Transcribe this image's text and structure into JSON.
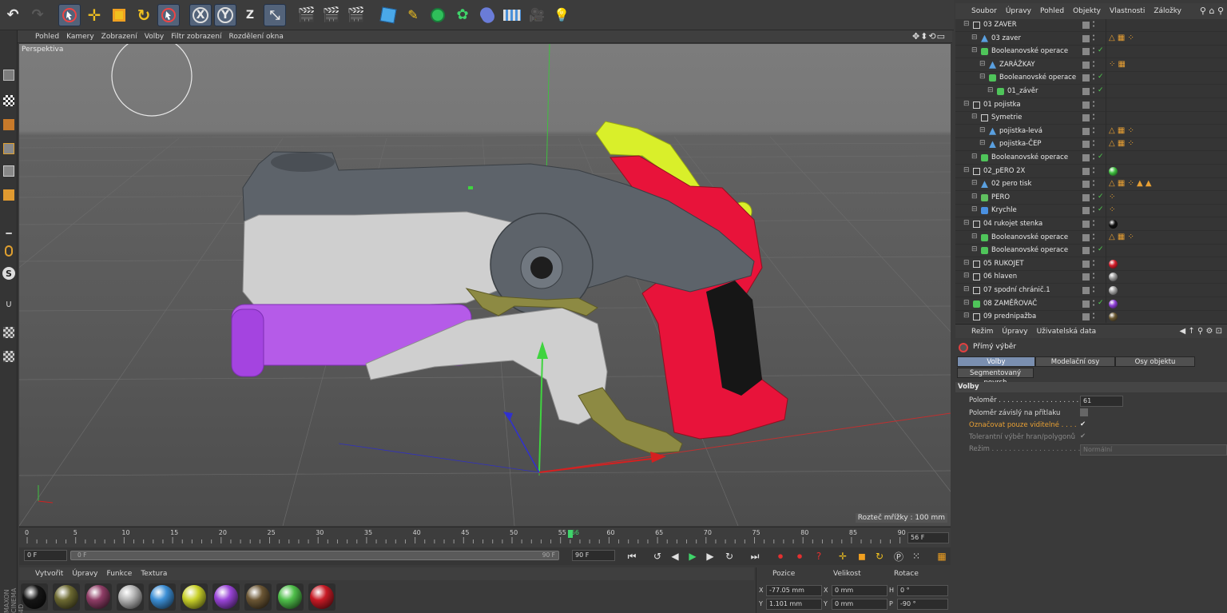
{
  "colors": {
    "accent": "#7a8fb0",
    "highlight_orange": "#e8a034",
    "check_green": "#4fd14f",
    "gun_gray": "#5d636a",
    "gun_white": "#cfcfcf",
    "gun_red": "#e8133a",
    "gun_yellow": "#d9ef2a",
    "gun_purple": "#b55be8",
    "gun_olive": "#8d8a43"
  },
  "top_toolbar": {
    "icons": [
      "undo-icon",
      "redo-icon",
      "live-select-icon",
      "move-icon",
      "scale-icon",
      "rotate-icon",
      "recent-tool-icon",
      "x-axis-lock",
      "y-axis-lock",
      "z-axis-lock",
      "world-coordinates-icon",
      "render-view-icon",
      "render-picture-viewer-icon",
      "render-settings-icon",
      "cube-icon",
      "pen-icon",
      "subdivision-icon",
      "array-icon",
      "deformer-icon",
      "floor-icon",
      "camera-icon",
      "light-icon"
    ],
    "x_label": "X",
    "y_label": "Y",
    "z_label": "Z"
  },
  "viewport": {
    "menu": [
      "Pohled",
      "Kamery",
      "Zobrazení",
      "Volby",
      "Filtr zobrazení",
      "Rozdělení okna"
    ],
    "label": "Perspektiva",
    "grid_spacing": "Rozteč mřížky : 100 mm"
  },
  "timeline": {
    "ticks": [
      "0",
      "5",
      "10",
      "15",
      "20",
      "25",
      "30",
      "35",
      "40",
      "45",
      "50",
      "55",
      "56",
      "60",
      "65",
      "70",
      "75",
      "80",
      "85",
      "90"
    ],
    "current_frame": "56 F",
    "start_field": "0 F",
    "range_start": "0 F",
    "range_end": "90 F",
    "end_field": "90 F"
  },
  "material_manager": {
    "menu": [
      "Vytvořit",
      "Úpravy",
      "Funkce",
      "Textura"
    ],
    "swatches": [
      "#151515",
      "#6d6a32",
      "#8f3d66",
      "#b5b5b5",
      "#3c8fd6",
      "#c9d12a",
      "#9a45d8",
      "#6b5634",
      "#4fbf4a",
      "#c81a25"
    ],
    "side_label": "MAXON CINEMA 4D"
  },
  "coordinates": {
    "headers": [
      "Pozice",
      "Velikost",
      "Rotace"
    ],
    "rows": [
      {
        "axis": "X",
        "pos": "-77.05 mm",
        "size_axis": "X",
        "size": "0 mm",
        "rot_axis": "H",
        "rot": "0 °"
      },
      {
        "axis": "Y",
        "pos": "1.101 mm",
        "size_axis": "Y",
        "size": "0 mm",
        "rot_axis": "P",
        "rot": "-90 °"
      }
    ]
  },
  "object_manager": {
    "menu": [
      "Soubor",
      "Úpravy",
      "Pohled",
      "Objekty",
      "Vlastnosti",
      "Záložky"
    ],
    "rows": [
      {
        "name": "03 ZAVER",
        "indent": 0,
        "icon": "null",
        "check": false,
        "tags": ""
      },
      {
        "name": "03 zaver",
        "indent": 1,
        "icon": "poly",
        "check": false,
        "tags": "△ ▦ ⁘"
      },
      {
        "name": "Booleanovské operace",
        "indent": 1,
        "icon": "bool",
        "check": true,
        "tags": ""
      },
      {
        "name": "ZARÁŽKAY",
        "indent": 2,
        "icon": "poly",
        "check": false,
        "tags": "⁘ ▦"
      },
      {
        "name": "Booleanovské operace",
        "indent": 2,
        "icon": "bool",
        "check": true,
        "tags": ""
      },
      {
        "name": "01_závěr",
        "indent": 3,
        "icon": "bool",
        "check": true,
        "tags": ""
      },
      {
        "name": "01 pojistka",
        "indent": 0,
        "icon": "null",
        "check": false,
        "tags": ""
      },
      {
        "name": "Symetrie",
        "indent": 1,
        "icon": "null",
        "check": false,
        "tags": ""
      },
      {
        "name": "pojistka-levá",
        "indent": 2,
        "icon": "poly",
        "check": false,
        "tags": "△ ▦ ⁘"
      },
      {
        "name": "pojistka-ČEP",
        "indent": 2,
        "icon": "poly",
        "check": false,
        "tags": "△ ▦ ⁘"
      },
      {
        "name": "Booleanovské operace",
        "indent": 1,
        "icon": "bool",
        "check": true,
        "tags": ""
      },
      {
        "name": "02_pERO 2X",
        "indent": 0,
        "icon": "null",
        "check": false,
        "tags": "●"
      },
      {
        "name": "02 pero tisk",
        "indent": 1,
        "icon": "poly",
        "check": false,
        "tags": "△ ▦ ⁘ ▲ ▲"
      },
      {
        "name": "PERO",
        "indent": 1,
        "icon": "spline",
        "check": true,
        "tags": "⁘"
      },
      {
        "name": "Krychle",
        "indent": 1,
        "icon": "cube",
        "check": true,
        "tags": "⁘"
      },
      {
        "name": "04 rukojet stenka",
        "indent": 0,
        "icon": "null",
        "check": false,
        "tags": "●"
      },
      {
        "name": "Booleanovské operace",
        "indent": 1,
        "icon": "bool",
        "check": false,
        "tags": "△ ▦ ⁘"
      },
      {
        "name": "Booleanovské operace",
        "indent": 1,
        "icon": "bool",
        "check": true,
        "tags": ""
      },
      {
        "name": "05 RUKOJET",
        "indent": 0,
        "icon": "null",
        "check": false,
        "tags": "●"
      },
      {
        "name": "06 hlaven",
        "indent": 0,
        "icon": "null",
        "check": false,
        "tags": "●"
      },
      {
        "name": "07 spodní chránič.1",
        "indent": 0,
        "icon": "null",
        "check": false,
        "tags": "●"
      },
      {
        "name": "08 ZAMĚŘOVAČ",
        "indent": 0,
        "icon": "bool",
        "check": true,
        "tags": "●"
      },
      {
        "name": "09 prednipažba",
        "indent": 0,
        "icon": "null",
        "check": false,
        "tags": "●"
      }
    ],
    "tag_sphere_colors": {
      "11": "#3fbf3f",
      "15": "#111111",
      "18": "#d41d2a",
      "19": "#9a9a9a",
      "20": "#a0a0a0",
      "21": "#8e3fd6",
      "22": "#6b5a34"
    }
  },
  "attribute_manager": {
    "menu": [
      "Režim",
      "Úpravy",
      "Uživatelská data"
    ],
    "tool_name": "Přímý výběr",
    "tabs": [
      "Volby",
      "Modelační osy",
      "Osy objektu"
    ],
    "tab2": "Segmentovaný povrch",
    "section": "Volby",
    "props": [
      {
        "label": "Poloměr . . . . . . . . . . . . . . . . . . . . . . . . . . .",
        "value": "61",
        "style": "normal"
      },
      {
        "label": "Poloměr závislý na přítlaku",
        "value": "",
        "style": "normal"
      },
      {
        "label": "Označovat pouze viditelné . . . .",
        "value": "✔",
        "style": "orange"
      },
      {
        "label": "Tolerantní výběr hran/polygonů",
        "value": "✔",
        "style": "dim"
      },
      {
        "label": "Režim . . . . . . . . . . . . . . . . . . . . . . . . . . . . . .",
        "value": "Normální",
        "style": "dim"
      }
    ]
  }
}
